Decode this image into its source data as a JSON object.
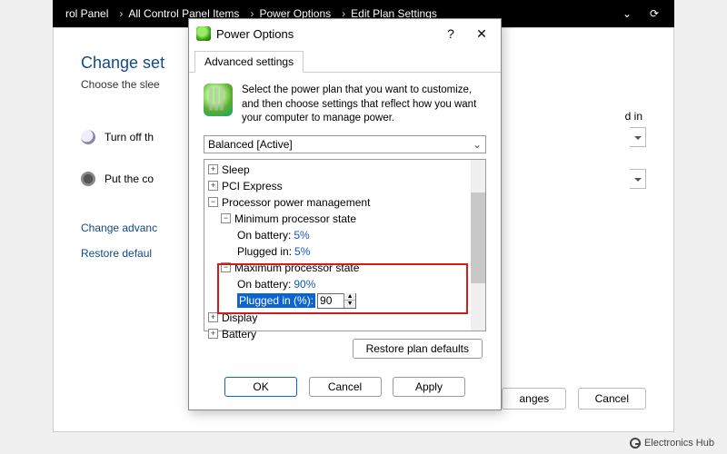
{
  "breadcrumb": {
    "items": [
      "rol Panel",
      "All Control Panel Items",
      "Power Options",
      "Edit Plan Settings"
    ]
  },
  "page": {
    "title_truncated": "Change set",
    "subtitle_truncated": "Choose the slee",
    "trailing_fragment": "d in",
    "row_display_truncated": "Turn off th",
    "row_sleep_truncated": "Put the co",
    "link_advanced_truncated": "Change advanc",
    "link_restore_truncated": "Restore defaul",
    "btn_save_truncated": "anges",
    "btn_cancel": "Cancel"
  },
  "dialog": {
    "title": "Power Options",
    "tab": "Advanced settings",
    "intro": "Select the power plan that you want to customize, and then choose settings that reflect how you want your computer to manage power.",
    "plan_selected": "Balanced [Active]",
    "restore_defaults": "Restore plan defaults",
    "ok": "OK",
    "cancel": "Cancel",
    "apply": "Apply"
  },
  "tree": {
    "sleep": "Sleep",
    "pci": "PCI Express",
    "ppm": "Processor power management",
    "min_state": "Minimum processor state",
    "min_batt_label": "On battery:",
    "min_batt_val": "5%",
    "min_plug_label": "Plugged in:",
    "min_plug_val": "5%",
    "max_state": "Maximum processor state",
    "max_batt_label": "On battery:",
    "max_batt_val": "90%",
    "max_plug_label": "Plugged in (%):",
    "max_plug_val": "90",
    "display": "Display",
    "battery": "Battery"
  },
  "watermark": "Electronics Hub"
}
